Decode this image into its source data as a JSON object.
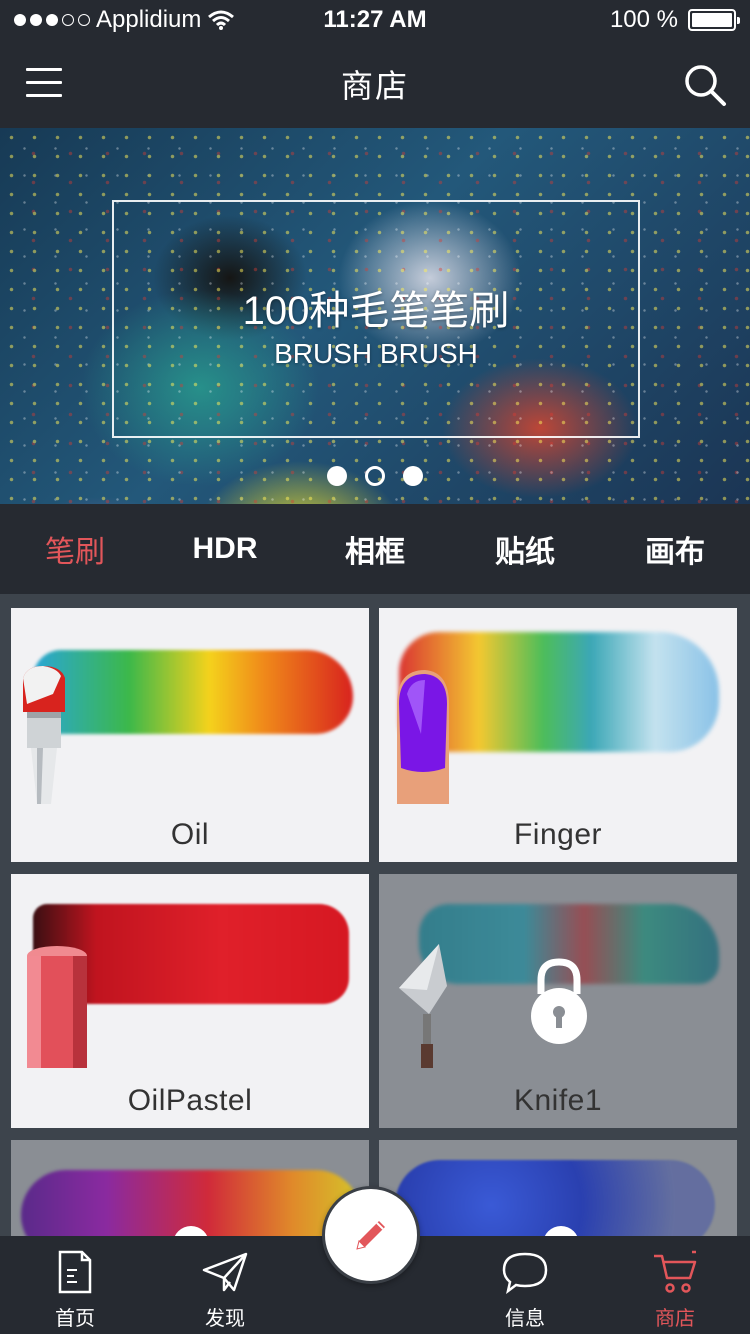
{
  "status_bar": {
    "carrier": "Applidium",
    "time": "11:27 AM",
    "battery": "100 %",
    "signal_filled": 3,
    "signal_total": 5,
    "battery_level": 1.0
  },
  "nav": {
    "title": "商店",
    "menu_icon": "hamburger-menu-icon",
    "search_icon": "search-icon"
  },
  "banner": {
    "title": "100种毛笔笔刷",
    "subtitle": "BRUSH BRUSH",
    "page_count": 3,
    "active_page": 2
  },
  "categories": [
    {
      "label": "笔刷",
      "active": true
    },
    {
      "label": "HDR",
      "active": false
    },
    {
      "label": "相框",
      "active": false
    },
    {
      "label": "贴纸",
      "active": false
    },
    {
      "label": "画布",
      "active": false
    }
  ],
  "brushes": [
    {
      "name": "Oil",
      "locked": false,
      "icon": "paint-brush-icon"
    },
    {
      "name": "Finger",
      "locked": false,
      "icon": "finger-icon"
    },
    {
      "name": "OilPastel",
      "locked": false,
      "icon": "pastel-stick-icon"
    },
    {
      "name": "Knife1",
      "locked": true,
      "icon": "palette-knife-icon"
    },
    {
      "name": "",
      "locked": true,
      "icon": "brush-icon"
    },
    {
      "name": "",
      "locked": true,
      "icon": "spray-icon"
    }
  ],
  "colors": {
    "accent": "#e2565a",
    "bar": "#262a31",
    "grid_bg": "#3d444c",
    "card": "#f2f2f4",
    "card_locked": "#8a8e94"
  },
  "bottom_tabs": [
    {
      "label": "首页",
      "icon": "document-icon",
      "active": false
    },
    {
      "label": "发现",
      "icon": "paper-plane-icon",
      "active": false
    },
    {
      "label": "",
      "icon": "pencil-icon",
      "active": false
    },
    {
      "label": "信息",
      "icon": "chat-bubble-icon",
      "active": false
    },
    {
      "label": "商店",
      "icon": "shopping-cart-icon",
      "active": true
    }
  ]
}
